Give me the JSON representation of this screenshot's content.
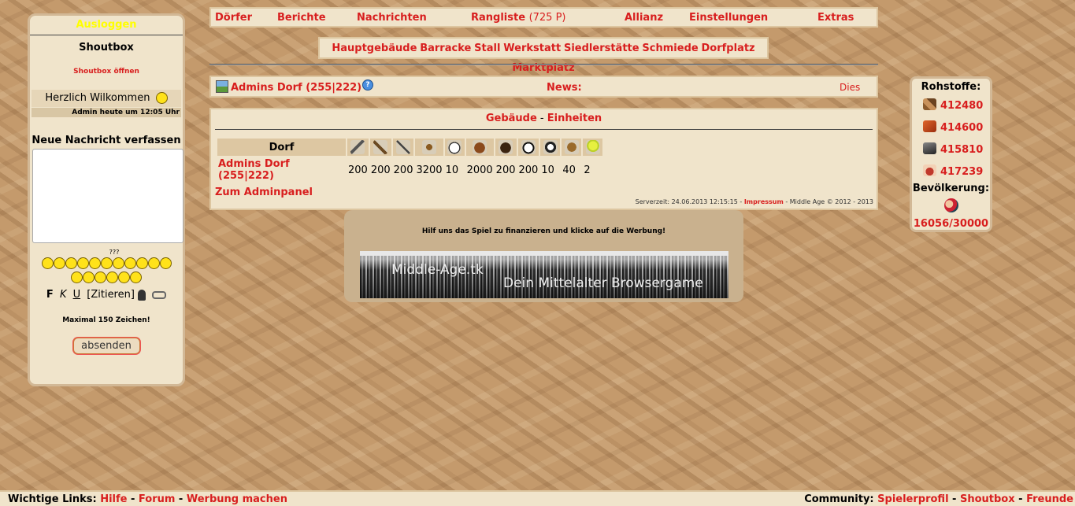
{
  "sidebar": {
    "logout_label": "Ausloggen",
    "shoutbox_title": "Shoutbox",
    "shoutbox_open_label": "Shoutbox öffnen",
    "welcome_text": "Herzlich Wilkommen",
    "welcome_meta": "Admin heute um 12:05 Uhr",
    "new_message_title": "Neue Nachricht verfassen",
    "message_value": "",
    "smiley_label": "???",
    "format": {
      "bold": "F",
      "italic": "K",
      "underline": "U",
      "quote": "[Zitieren]"
    },
    "max_chars": "Maximal 150 Zeichen!",
    "send_label": "absenden"
  },
  "topnav": {
    "items": [
      "Dörfer",
      "Berichte",
      "Nachrichten",
      "Rangliste",
      "Allianz",
      "Einstellungen",
      "Extras"
    ],
    "rank_points": "(725 P)"
  },
  "buildings": [
    "Hauptgebäude",
    "Barracke",
    "Stall",
    "Werkstatt",
    "Siedlerstätte",
    "Schmiede",
    "Dorfplatz",
    "Marktplatz"
  ],
  "village_bar": {
    "village": "Admins Dorf (255|222)",
    "help": "?",
    "news_label": "News:",
    "news_text": "Dies"
  },
  "main": {
    "tab_buildings": "Gebäude",
    "tab_sep": " - ",
    "tab_units": "Einheiten",
    "table": {
      "header": "Dorf",
      "unit_icons": [
        "sword-icon",
        "axe-icon",
        "spear-icon",
        "archer-icon",
        "scout-icon",
        "light-cavalry-icon",
        "heavy-cavalry-icon",
        "mounted-archer-icon",
        "ram-icon",
        "catapult-icon",
        "nobleman-icon"
      ],
      "row": {
        "village": "Admins Dorf (255|222)",
        "values": [
          "200",
          "200",
          "200",
          "3200",
          "10",
          "2000",
          "200",
          "200",
          "10",
          "40",
          "2"
        ]
      }
    },
    "admin_panel_label": "Zum Adminpanel",
    "server_time_prefix": "Serverzeit: 24.06.2013 12:15:15 - ",
    "impressum_label": "Impressum",
    "copyright": " - Middle Age © 2012 - 2013"
  },
  "ad": {
    "note": "Hilf uns das Spiel zu finanzieren und klicke auf die Werbung!",
    "banner_title": "Middle-Age.tk",
    "banner_subtitle": "Dein Mittelalter Browsergame"
  },
  "resources": {
    "title": "Rohstoffe:",
    "items": [
      {
        "icon": "wood-icon",
        "value": "412480"
      },
      {
        "icon": "clay-icon",
        "value": "414600"
      },
      {
        "icon": "iron-icon",
        "value": "415810"
      },
      {
        "icon": "food-icon",
        "value": "417239"
      }
    ],
    "population_title": "Bevölkerung:",
    "population_value": "16056/30000"
  },
  "bottom": {
    "left_label": "Wichtige Links:",
    "left_links": [
      "Hilfe",
      "Forum",
      "Werbung machen"
    ],
    "right_label": "Community:",
    "right_links": [
      "Spielerprofil",
      "Shoutbox",
      "Freunde"
    ]
  },
  "colors": {
    "link": "#d81e1e",
    "panel": "#f0e4cb",
    "logout": "#ffff00"
  }
}
